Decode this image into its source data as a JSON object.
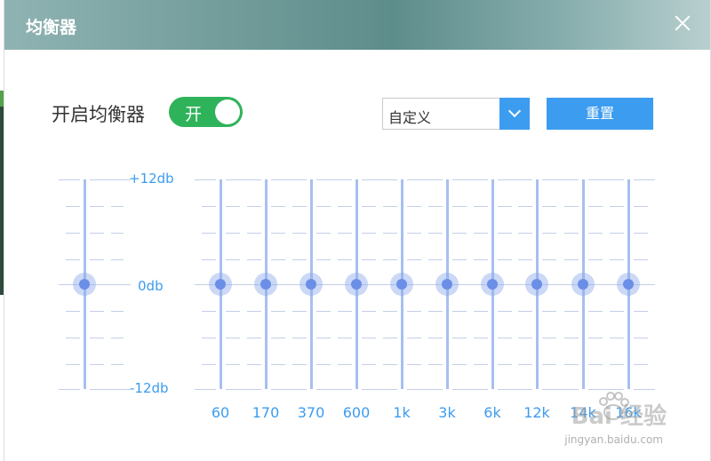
{
  "window": {
    "title": "均衡器"
  },
  "toggle": {
    "label": "开启均衡器",
    "state_text": "开",
    "on": true
  },
  "preset": {
    "value": "自定义"
  },
  "reset_button": {
    "label": "重置"
  },
  "db_scale": {
    "max": "+12db",
    "mid": "0db",
    "min": "-12db"
  },
  "preamp": {
    "gain_db": 0
  },
  "bands": [
    {
      "freq": "60",
      "gain_db": 0
    },
    {
      "freq": "170",
      "gain_db": 0
    },
    {
      "freq": "370",
      "gain_db": 0
    },
    {
      "freq": "600",
      "gain_db": 0
    },
    {
      "freq": "1k",
      "gain_db": 0
    },
    {
      "freq": "3k",
      "gain_db": 0
    },
    {
      "freq": "6k",
      "gain_db": 0
    },
    {
      "freq": "12k",
      "gain_db": 0
    },
    {
      "freq": "14k",
      "gain_db": 0
    },
    {
      "freq": "16k",
      "gain_db": 0
    }
  ],
  "watermark": {
    "brand": "Bai 经验",
    "url": "jingyan.baidu.com"
  },
  "colors": {
    "accent": "#3c9cf0",
    "toggle_on": "#2fb35a",
    "slider": "#6b8fe6"
  }
}
